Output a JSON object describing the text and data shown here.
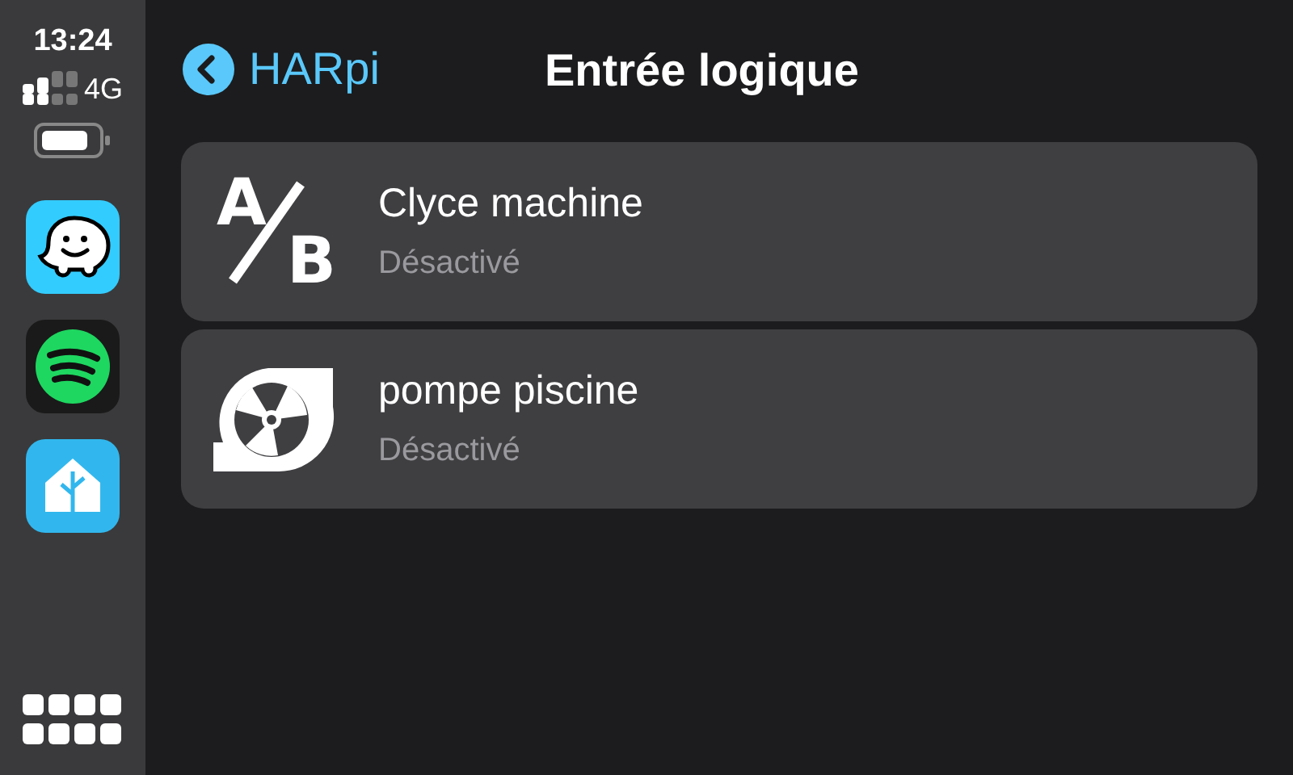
{
  "status": {
    "time": "13:24",
    "network": "4G"
  },
  "apps": [
    {
      "kind": "waze"
    },
    {
      "kind": "spotify"
    },
    {
      "kind": "home"
    }
  ],
  "header": {
    "back": "HARpi",
    "title": "Entrée logique"
  },
  "items": [
    {
      "kind": "ab",
      "letters": [
        "A",
        "B"
      ],
      "name": "Clyce machine",
      "state": "Désactivé"
    },
    {
      "kind": "pump",
      "name": "pompe piscine",
      "state": "Désactivé"
    }
  ]
}
